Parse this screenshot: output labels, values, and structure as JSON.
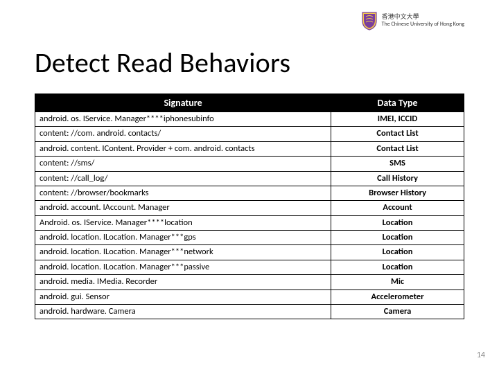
{
  "header": {
    "uni_cn": "香港中文大學",
    "uni_en": "The Chinese University of Hong Kong"
  },
  "title": "Detect Read Behaviors",
  "table": {
    "columns": [
      "Signature",
      "Data Type"
    ],
    "rows": [
      {
        "signature": "android. os. IService. Manager****iphonesubinfo",
        "datatype": "IMEI, ICCID"
      },
      {
        "signature": "content: //com. android. contacts/",
        "datatype": "Contact List"
      },
      {
        "signature": "android. content. IContent. Provider + com. android. contacts",
        "datatype": "Contact List"
      },
      {
        "signature": "content: //sms/",
        "datatype": "SMS"
      },
      {
        "signature": "content: //call_log/",
        "datatype": "Call History"
      },
      {
        "signature": "content: //browser/bookmarks",
        "datatype": "Browser History"
      },
      {
        "signature": "android. account. IAccount. Manager",
        "datatype": "Account"
      },
      {
        "signature": "Android. os. IService. Manager****location",
        "datatype": "Location"
      },
      {
        "signature": "android. location. ILocation. Manager***gps",
        "datatype": "Location"
      },
      {
        "signature": "android. location. ILocation. Manager***network",
        "datatype": "Location"
      },
      {
        "signature": "android. location. ILocation. Manager***passive",
        "datatype": "Location"
      },
      {
        "signature": "android. media. IMedia. Recorder",
        "datatype": "Mic"
      },
      {
        "signature": "android. gui. Sensor",
        "datatype": "Accelerometer"
      },
      {
        "signature": "android. hardware. Camera",
        "datatype": "Camera"
      }
    ]
  },
  "page_number": "14"
}
